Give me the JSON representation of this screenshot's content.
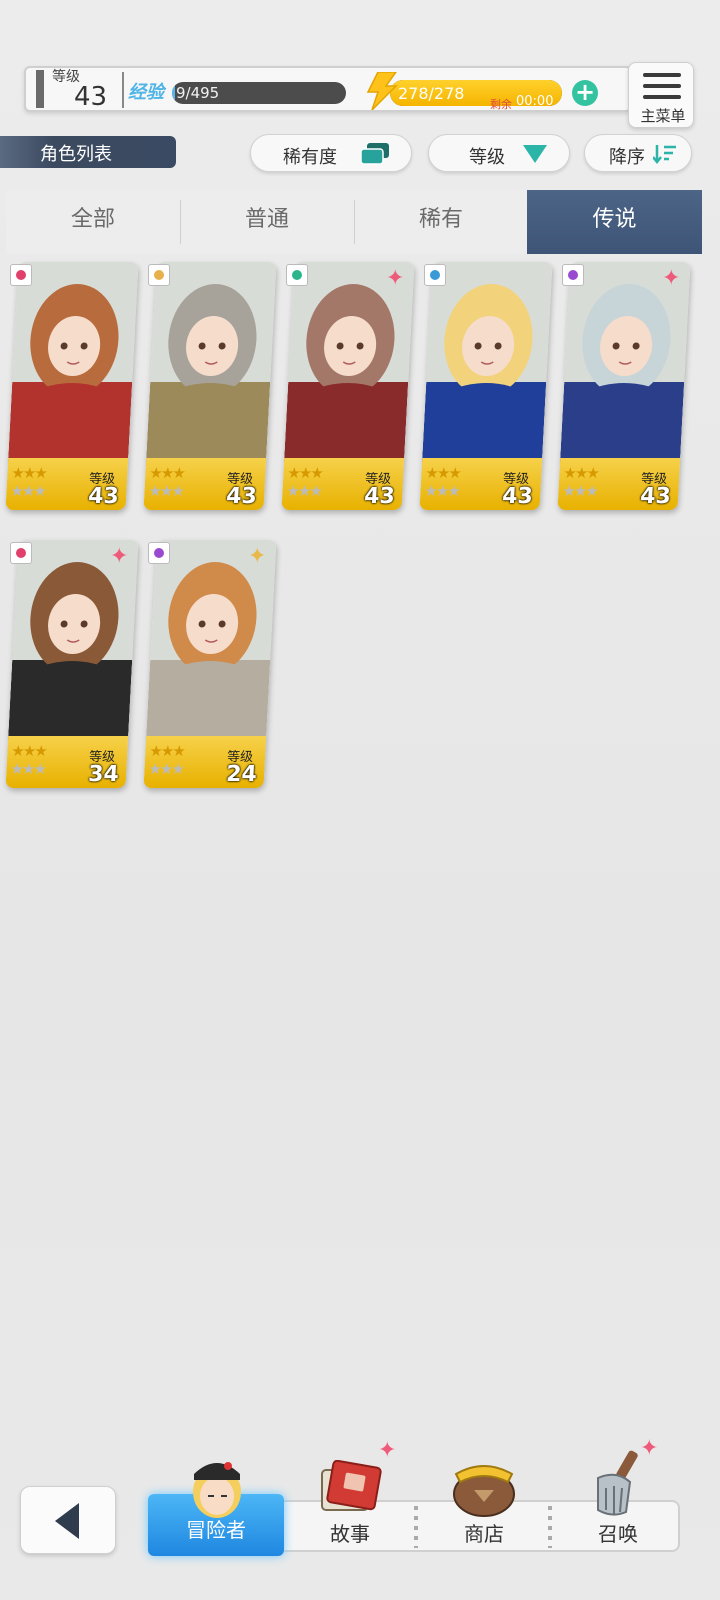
{
  "player": {
    "level_label": "等级",
    "level": "43",
    "exp_label": "经验",
    "exp_text": "9/495",
    "exp_progress": 0.018,
    "stamina_text": "278/278",
    "stamina_progress": 1.0,
    "remain_label": "剩余",
    "remain_time": "00:00"
  },
  "menu": {
    "label": "主菜单"
  },
  "list": {
    "title": "角色列表"
  },
  "filters": {
    "rarity": "稀有度",
    "level": "等级",
    "order": "降序"
  },
  "tabs": [
    {
      "label": "全部"
    },
    {
      "label": "普通"
    },
    {
      "label": "稀有"
    },
    {
      "label": "传说"
    }
  ],
  "active_tab": "传说",
  "characters": [
    {
      "level_label": "等级",
      "level": "43",
      "stars": 3,
      "element": "fire",
      "accent": "#b2332e",
      "hair": "#b86b3c",
      "sparkle": false
    },
    {
      "level_label": "等级",
      "level": "43",
      "stars": 3,
      "element": "light",
      "accent": "#9c8a5a",
      "hair": "#a8a39a",
      "sparkle": false
    },
    {
      "level_label": "等级",
      "level": "43",
      "stars": 3,
      "element": "wind",
      "accent": "#8a2b2b",
      "hair": "#a37868",
      "sparkle": true
    },
    {
      "level_label": "等级",
      "level": "43",
      "stars": 3,
      "element": "water",
      "accent": "#1f3f9a",
      "hair": "#f2d27a",
      "sparkle": false
    },
    {
      "level_label": "等级",
      "level": "43",
      "stars": 3,
      "element": "dark",
      "accent": "#2a3e8a",
      "hair": "#c7d4d8",
      "sparkle": true
    },
    {
      "level_label": "等级",
      "level": "34",
      "stars": 3,
      "element": "fire",
      "accent": "#2a2a2a",
      "hair": "#8a5a38",
      "sparkle": true
    },
    {
      "level_label": "等级",
      "level": "24",
      "stars": 3,
      "element": "dark",
      "accent": "#b4ada0",
      "hair": "#d08a4a",
      "sparkle": true
    }
  ],
  "nav": {
    "adventurer": "冒险者",
    "story": "故事",
    "shop": "商店",
    "summon": "召唤"
  }
}
